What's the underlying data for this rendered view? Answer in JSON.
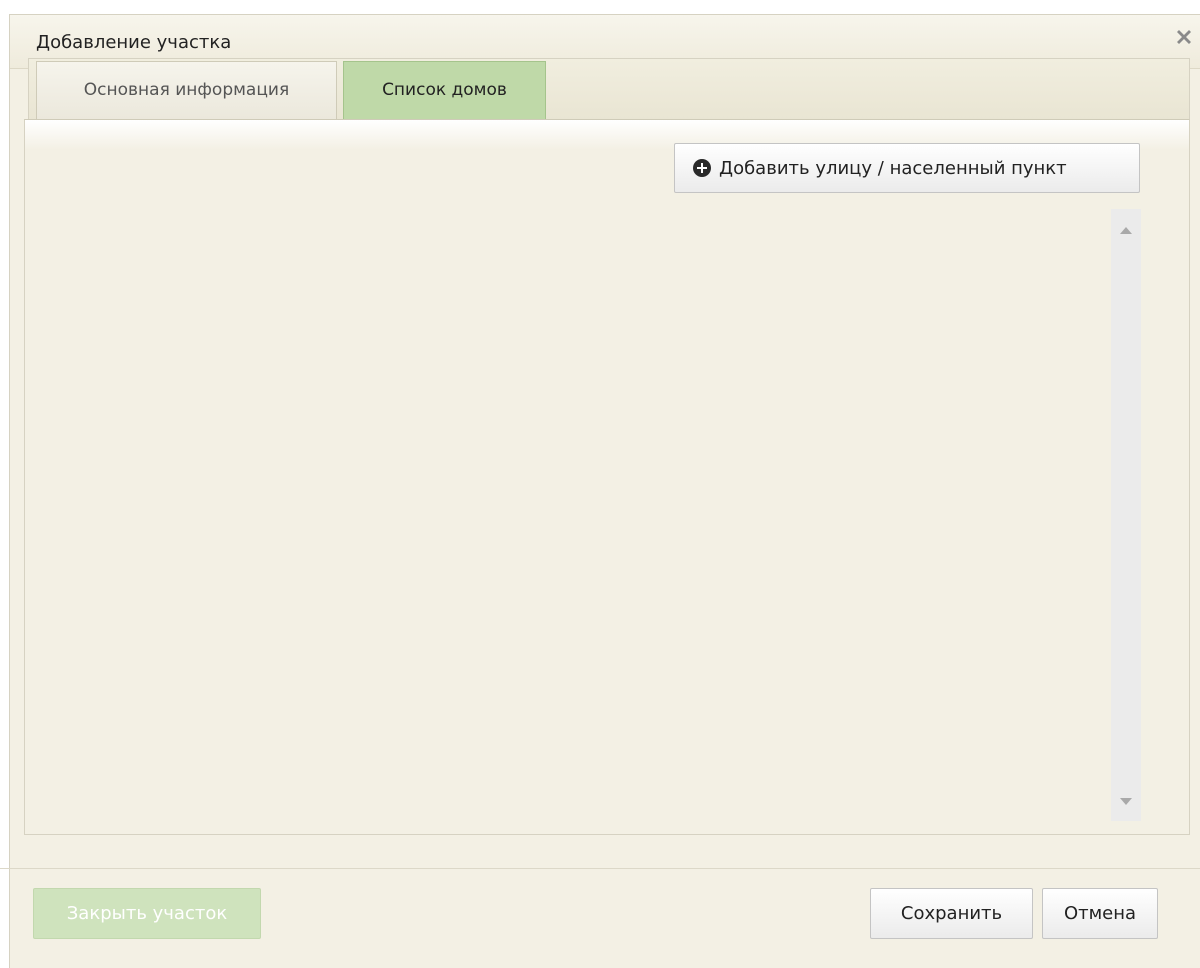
{
  "dialog": {
    "title": "Добавление участка"
  },
  "tabs": [
    {
      "label": "Основная информация",
      "active": false
    },
    {
      "label": "Список домов",
      "active": true
    }
  ],
  "houses_panel": {
    "add_button_label": "Добавить улицу / населенный пункт",
    "add_button_icon": "plus-circle-icon"
  },
  "footer": {
    "close_area_label": "Закрыть участок",
    "save_label": "Сохранить",
    "cancel_label": "Отмена"
  },
  "colors": {
    "background": "#f3f0e4",
    "active_tab": "#bfd9a8",
    "disabled_button": "#cfe3bd"
  }
}
